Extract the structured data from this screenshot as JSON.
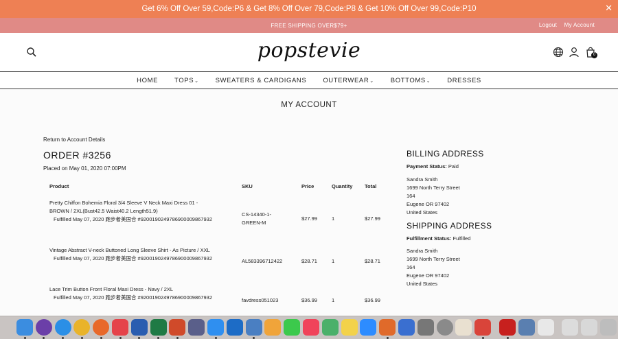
{
  "promo": {
    "text": "Get 6% Off Over 59,Code:P6 & Get 8% Off Over 79,Code:P8 & Get 10% Off Over 99,Code:P10",
    "close": "✕"
  },
  "shipbar": {
    "text": "FREE SHIPPING OVER$79+",
    "logout": "Logout",
    "my_account": "My Account"
  },
  "header": {
    "logo": "popstevie",
    "cart_count": "0",
    "icons": [
      "search-icon",
      "globe-icon",
      "user-icon",
      "cart-icon"
    ]
  },
  "nav": {
    "items": [
      {
        "label": "HOME",
        "dropdown": false
      },
      {
        "label": "TOPS",
        "dropdown": true
      },
      {
        "label": "SWEATERS & CARDIGANS",
        "dropdown": false
      },
      {
        "label": "OUTERWEAR",
        "dropdown": true
      },
      {
        "label": "BOTTOMS",
        "dropdown": true
      },
      {
        "label": "DRESSES",
        "dropdown": false
      }
    ],
    "chevron": "⌄"
  },
  "page": {
    "title": "MY ACCOUNT",
    "back_link": "Return to Account Details",
    "order_number": "ORDER #3256",
    "placed_on": "Placed on May 01, 2020 07:00PM"
  },
  "table": {
    "headers": {
      "product": "Product",
      "sku": "SKU",
      "price": "Price",
      "quantity": "Quantity",
      "total": "Total"
    },
    "rows": [
      {
        "product_line1": "Pretty Chiffon Bohemia Floral 3/4 Sleeve V Neck Maxi Dress 01 -",
        "product_line2": "BROWN / 2XL(Bust42.5 Waist40.2 Length51.9)",
        "fulfilled": "Fulfilled May 07, 2020 跑步者美国合 #9200190249786900009867932",
        "sku_line1": "CS-14340-1-",
        "sku_line2": "GREEN-M",
        "price": "$27.99",
        "quantity": "1",
        "total": "$27.99"
      },
      {
        "product_line1": "Vintage Abstract V-neck Buttoned Long Sleeve Shirt - As Picture / XXL",
        "product_line2": "",
        "fulfilled": "Fulfilled May 07, 2020 跑步者美国合 #9200190249786900009867932",
        "sku_line1": "AL583396712422",
        "sku_line2": "",
        "price": "$28.71",
        "quantity": "1",
        "total": "$28.71"
      },
      {
        "product_line1": "Lace Trim Button Front Floral Maxi Dress - Navy / 2XL",
        "product_line2": "",
        "fulfilled": "Fulfilled May 07, 2020 跑步者美国合 #9200190249786900009867932",
        "sku_line1": "favdress051023",
        "sku_line2": "",
        "price": "$36.99",
        "quantity": "1",
        "total": "$36.99"
      }
    ]
  },
  "billing": {
    "heading": "BILLING ADDRESS",
    "status_label": "Payment Status:",
    "status_value": "Paid",
    "name": "Sandra Smith",
    "street": "1699 North Terry Street",
    "unit": "164",
    "city": "Eugene OR 97402",
    "country": "United States"
  },
  "shipping": {
    "heading": "SHIPPING ADDRESS",
    "status_label": "Fulfillment Status:",
    "status_value": "Fulfilled",
    "name": "Sandra Smith",
    "street": "1699 North Terry Street",
    "unit": "164",
    "city": "Eugene OR 97402",
    "country": "United States"
  },
  "dock": {
    "apps": [
      {
        "name": "finder-icon",
        "color": "#3b8de0"
      },
      {
        "name": "siri-icon",
        "color": "#6b3fa8"
      },
      {
        "name": "safari-icon",
        "color": "#2b8fe6"
      },
      {
        "name": "chrome-icon",
        "color": "#e9b32a"
      },
      {
        "name": "firefox-icon",
        "color": "#e8682a"
      },
      {
        "name": "news-icon",
        "color": "#e5434a"
      },
      {
        "name": "word-icon",
        "color": "#2a5db0"
      },
      {
        "name": "excel-icon",
        "color": "#1f7a45"
      },
      {
        "name": "powerpoint-icon",
        "color": "#d04a2a"
      },
      {
        "name": "pen-icon",
        "color": "#5a5f8a"
      },
      {
        "name": "app-store-icon",
        "color": "#2f8ff0"
      },
      {
        "name": "outlook-icon",
        "color": "#1d6cc6"
      },
      {
        "name": "xcode-icon",
        "color": "#4a7fc2"
      },
      {
        "name": "photos-icon",
        "color": "#f0a43a"
      },
      {
        "name": "messages-icon",
        "color": "#3cc94c"
      },
      {
        "name": "music-icon",
        "color": "#f0435a"
      },
      {
        "name": "maps-icon",
        "color": "#4bb06a"
      },
      {
        "name": "notes-icon",
        "color": "#f3d24a"
      },
      {
        "name": "zoom-icon",
        "color": "#2d8cff"
      },
      {
        "name": "preview-icon",
        "color": "#e06a2a"
      },
      {
        "name": "calculator-icon",
        "color": "#3a6fd0"
      },
      {
        "name": "disk-utility-icon",
        "color": "#777777"
      },
      {
        "name": "system-preferences-icon",
        "color": "#8a8a8a"
      },
      {
        "name": "textedit-icon",
        "color": "#e9e0d0"
      },
      {
        "name": "photo-booth-icon",
        "color": "#d9443a"
      },
      {
        "name": "acrobat-icon",
        "color": "#c7201e"
      },
      {
        "name": "image-capture-icon",
        "color": "#5a7fb0"
      },
      {
        "name": "documents-icon",
        "color": "#e8e8e8"
      },
      {
        "name": "screenshots-icon",
        "color": "#dcdcdc"
      },
      {
        "name": "downloads-icon",
        "color": "#d8d8d8"
      },
      {
        "name": "trash-icon",
        "color": "#bdbdbd"
      }
    ]
  }
}
